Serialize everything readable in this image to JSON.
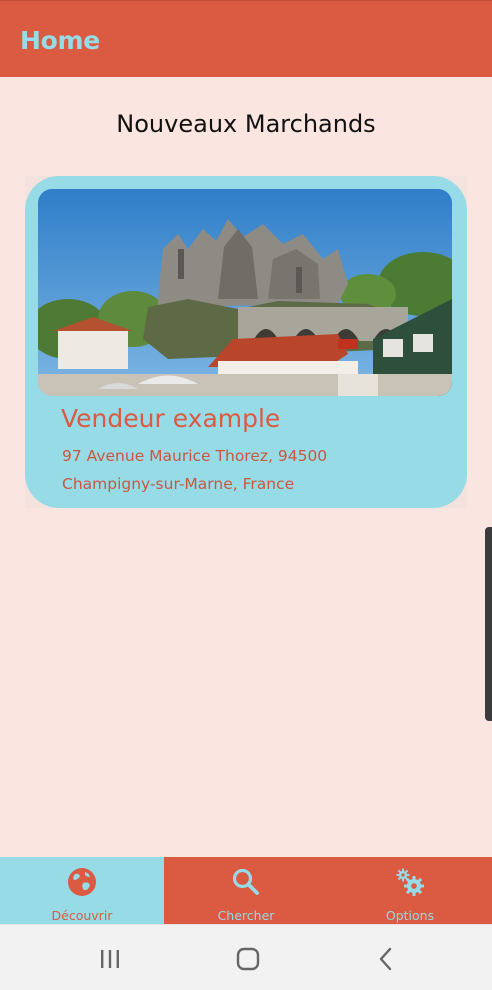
{
  "app_bar": {
    "title": "Home"
  },
  "section": {
    "title": "Nouveaux Marchands"
  },
  "merchants": [
    {
      "name": "Vendeur example",
      "address_line1": "97 Avenue Maurice Thorez, 94500",
      "address_line2": "Champigny-sur-Marne, France",
      "image": "town-church-photo"
    }
  ],
  "bottom_nav": {
    "items": [
      {
        "label": "Découvrir",
        "icon": "globe-icon",
        "active": true
      },
      {
        "label": "Chercher",
        "icon": "search-icon",
        "active": false
      },
      {
        "label": "Options",
        "icon": "gears-icon",
        "active": false
      }
    ]
  },
  "system_nav": {
    "buttons": [
      "recent-apps-icon",
      "home-icon",
      "back-icon"
    ]
  },
  "colors": {
    "primary": "#da5b42",
    "accent": "#97dbe6",
    "background": "#fbe5e1"
  }
}
